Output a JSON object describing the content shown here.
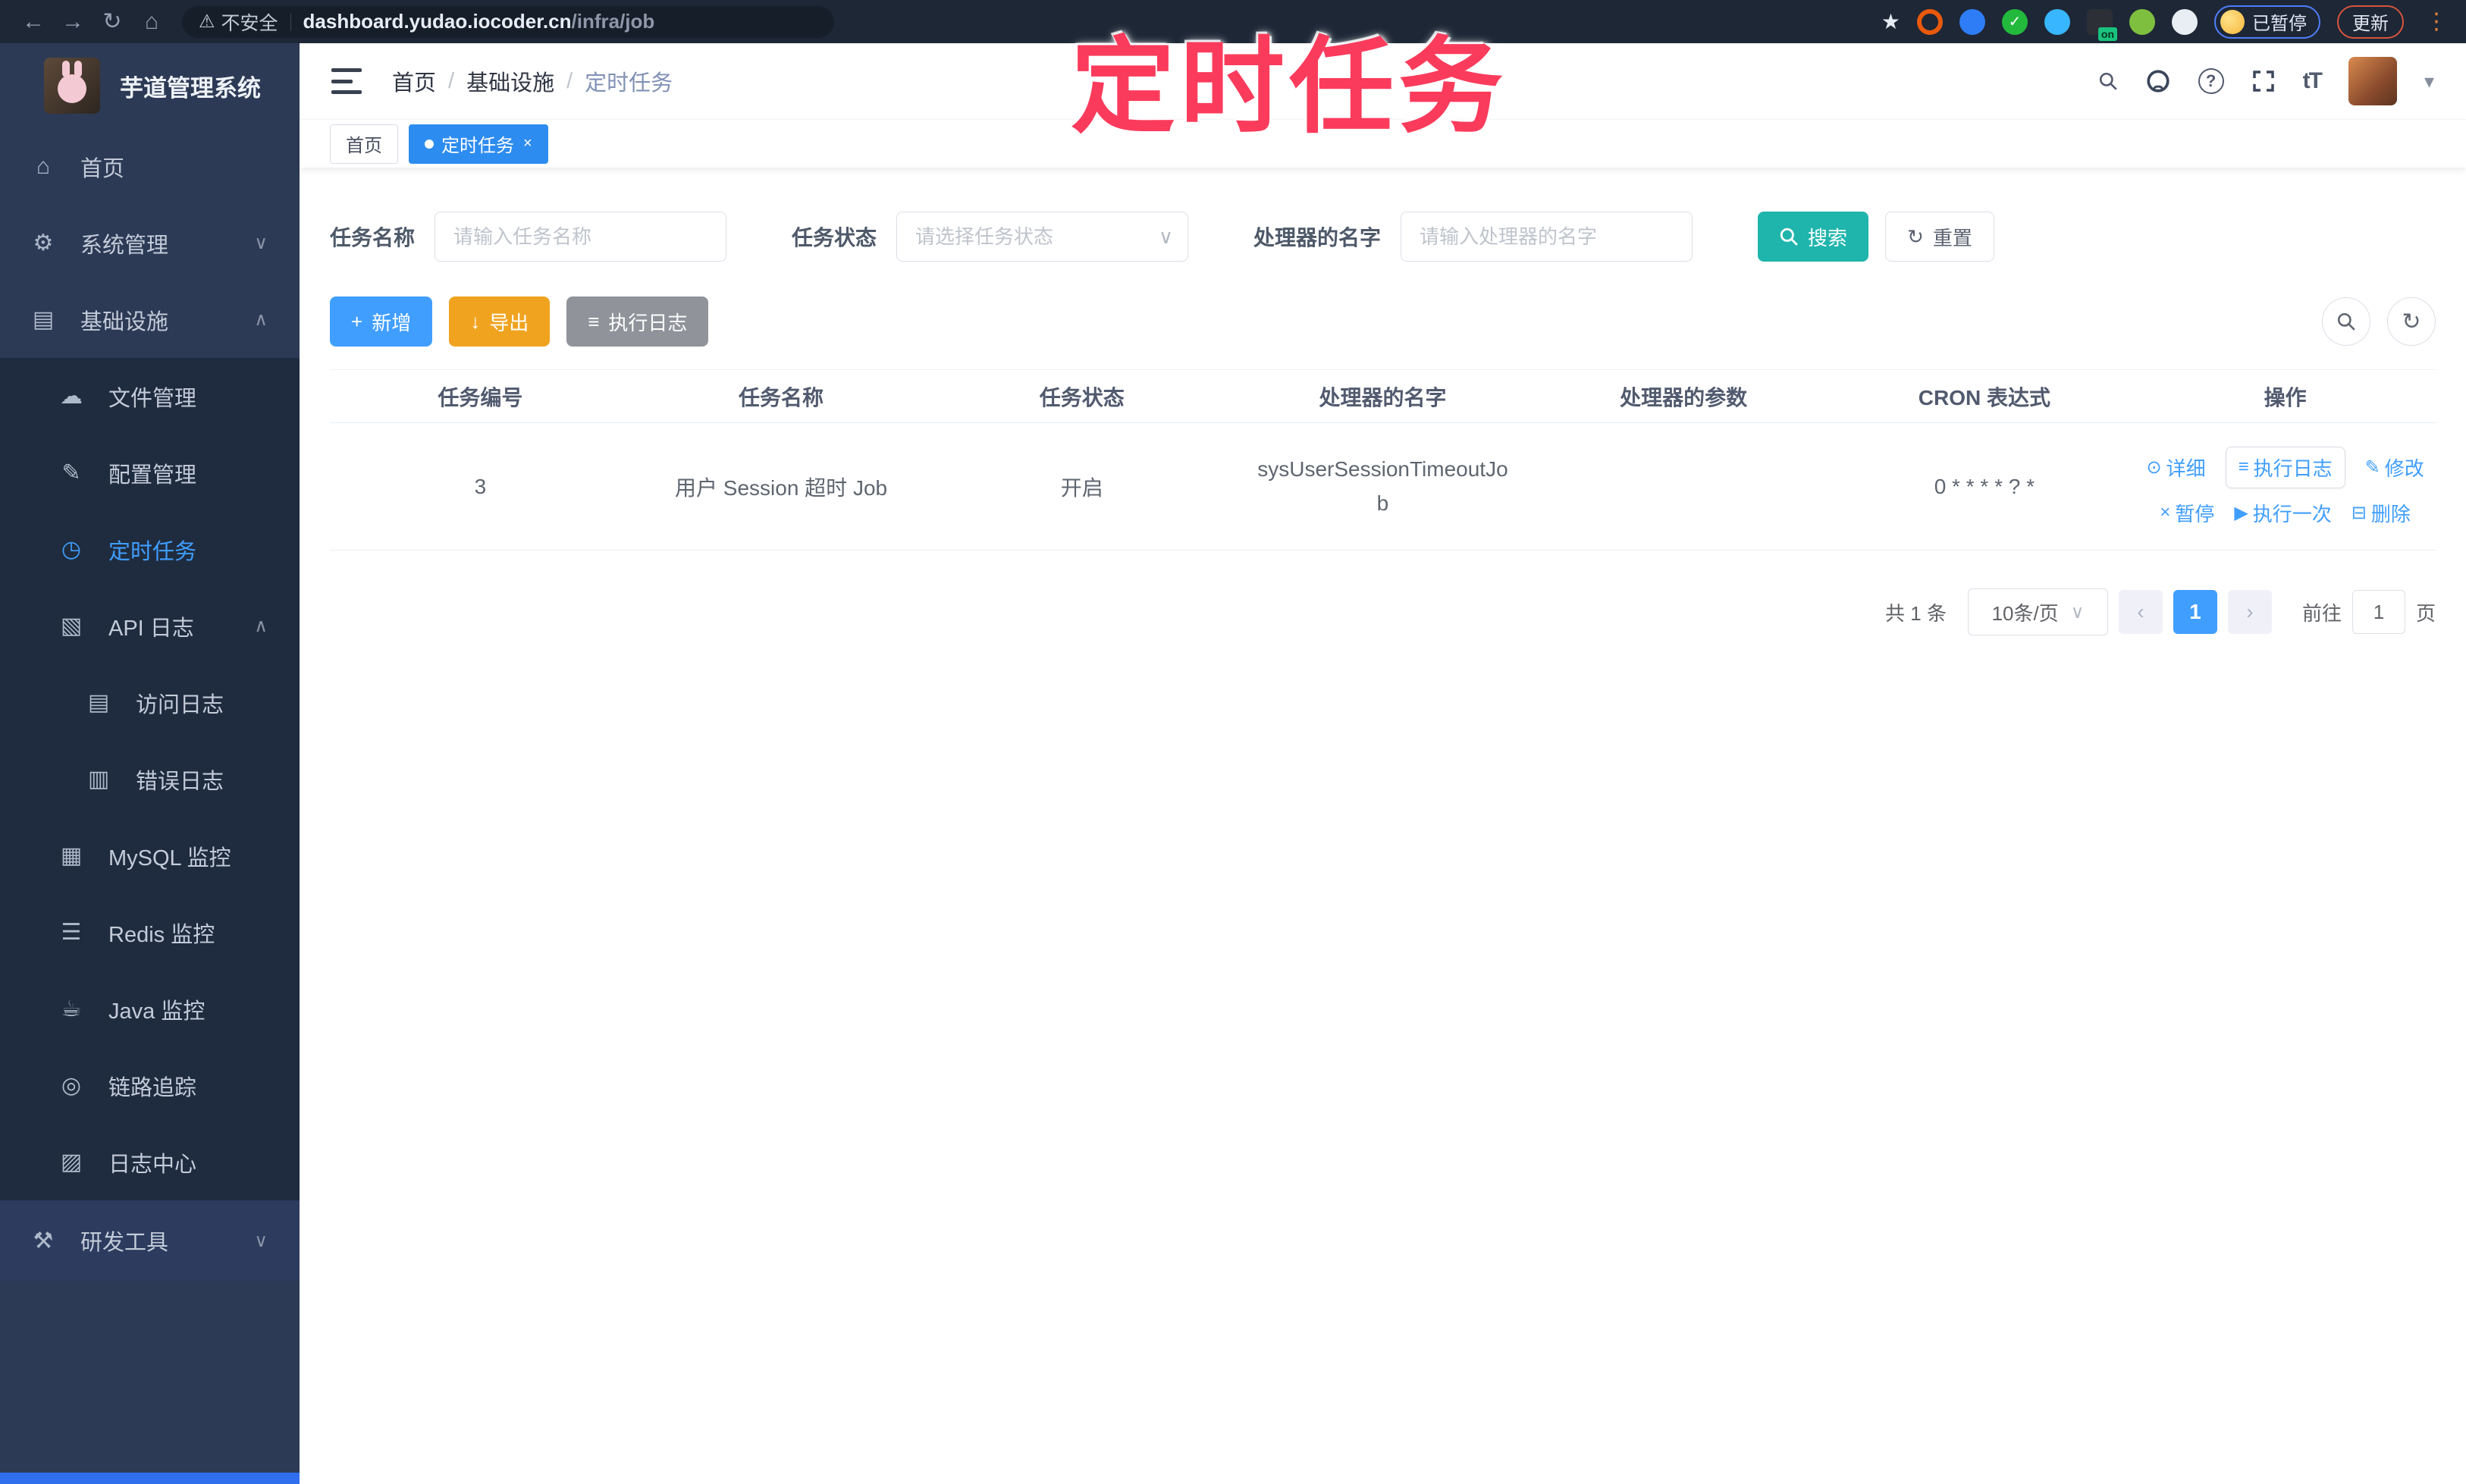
{
  "colors": {
    "primary": "#409eff",
    "search_teal": "#1fb5ad",
    "export_orange": "#f0a31f",
    "info_gray": "#909399",
    "annotation_pink": "#fb3b5c",
    "tag_active_blue": "#2d8cf0",
    "sidebar_bg": "#2d3a55",
    "submenu_bg": "#1f2c3f"
  },
  "icons": {
    "back": "←",
    "forward": "→",
    "reload": "↻",
    "home": "⌂",
    "warning": "⚠",
    "star": "★",
    "check": "✓",
    "on_badge": "on",
    "kebab": "⋮",
    "caret_down": "▾",
    "chevron_down": "∨",
    "chevron_up": "∧",
    "select_chevron": "∨",
    "menu_home": "⌂",
    "menu_system": "⚙",
    "menu_infra": "▤",
    "menu_file": "☁",
    "menu_config": "✎",
    "menu_job": "◷",
    "menu_api_log": "▧",
    "menu_access_log": "▤",
    "menu_error_log": "▥",
    "menu_mysql": "▦",
    "menu_redis": "☰",
    "menu_java": "☕",
    "menu_trace": "◎",
    "menu_log_center": "▨",
    "menu_devtool": "⚒",
    "plus": "+",
    "download": "↓",
    "list": "≡",
    "refresh": "↻",
    "eye": "⊙",
    "edit": "✎",
    "pause": "×",
    "play": "▶",
    "trash": "⊟",
    "font_size": "tT",
    "help": "?",
    "breadcrumb_sep": "/",
    "page_prev": "‹",
    "page_next": "›"
  },
  "browser": {
    "security_label": "不安全",
    "url_domain": "dashboard.yudao.iocoder.cn",
    "url_path": "/infra/job",
    "paused_badge": "已暂停",
    "update_button": "更新"
  },
  "annotation": {
    "text": "定时任务"
  },
  "sidebar": {
    "app_title": "芋道管理系统",
    "items": [
      {
        "label": "首页"
      },
      {
        "label": "系统管理"
      },
      {
        "label": "基础设施"
      },
      {
        "label": "文件管理"
      },
      {
        "label": "配置管理"
      },
      {
        "label": "定时任务"
      },
      {
        "label": "API 日志"
      },
      {
        "label": "访问日志"
      },
      {
        "label": "错误日志"
      },
      {
        "label": "MySQL 监控"
      },
      {
        "label": "Redis 监控"
      },
      {
        "label": "Java 监控"
      },
      {
        "label": "链路追踪"
      },
      {
        "label": "日志中心"
      },
      {
        "label": "研发工具"
      }
    ]
  },
  "header": {
    "breadcrumb": [
      "首页",
      "基础设施",
      "定时任务"
    ]
  },
  "tags": {
    "home": "首页",
    "active": "定时任务",
    "close": "×"
  },
  "filters": {
    "name_label": "任务名称",
    "name_placeholder": "请输入任务名称",
    "status_label": "任务状态",
    "status_placeholder": "请选择任务状态",
    "handler_label": "处理器的名字",
    "handler_placeholder": "请输入处理器的名字",
    "search_label": "搜索",
    "reset_label": "重置"
  },
  "toolbar": {
    "add_label": "新增",
    "export_label": "导出",
    "exec_log_label": "执行日志"
  },
  "table": {
    "columns": [
      "任务编号",
      "任务名称",
      "任务状态",
      "处理器的名字",
      "处理器的参数",
      "CRON 表达式",
      "操作"
    ],
    "rows": [
      {
        "id": "3",
        "name": "用户 Session 超时 Job",
        "status": "开启",
        "handler": "sysUserSessionTimeoutJob",
        "param": "",
        "cron": "0 * * * * ? *",
        "actions1": [
          "详细",
          "执行日志",
          "修改"
        ],
        "actions2": [
          "暂停",
          "执行一次",
          "删除"
        ]
      }
    ]
  },
  "pagination": {
    "total_text": "共 1 条",
    "page_size": "10条/页",
    "current_page": "1",
    "goto_label": "前往",
    "goto_value": "1",
    "page_unit": "页"
  }
}
